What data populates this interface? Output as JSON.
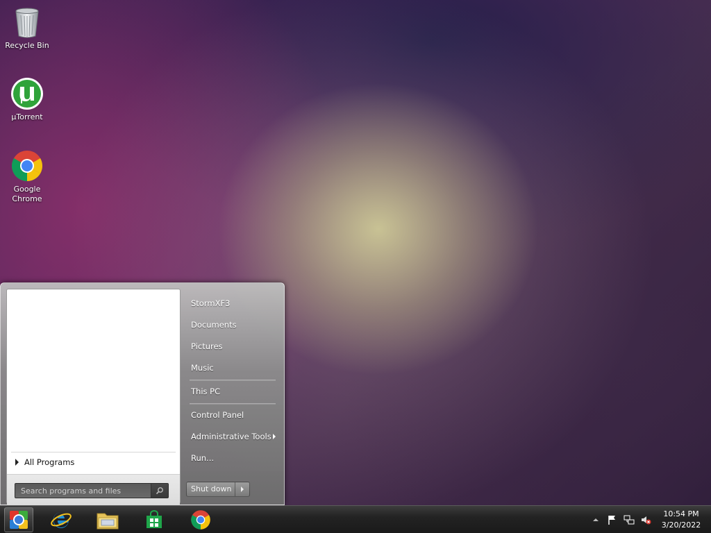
{
  "desktop": {
    "icons": [
      {
        "label": "Recycle Bin"
      },
      {
        "label": "µTorrent"
      },
      {
        "label": "Google Chrome"
      }
    ]
  },
  "start_menu": {
    "all_programs": "All Programs",
    "search": {
      "placeholder": "Search programs and files"
    },
    "right_items": {
      "user": "StormXF3",
      "documents": "Documents",
      "pictures": "Pictures",
      "music": "Music",
      "this_pc": "This PC",
      "control_panel": "Control Panel",
      "admin_tools": "Administrative Tools",
      "run": "Run..."
    },
    "shutdown_label": "Shut down"
  },
  "taskbar": {
    "clock": {
      "time": "10:54 PM",
      "date": "3/20/2022"
    }
  },
  "colors": {
    "utorrent_green": "#2fa33a",
    "chrome_red": "#db4437",
    "chrome_yellow": "#f4c20d",
    "chrome_green": "#0f9d58",
    "chrome_blue": "#4285f4",
    "ie_blue": "#1e8fd6",
    "store_green": "#1fa64a"
  }
}
